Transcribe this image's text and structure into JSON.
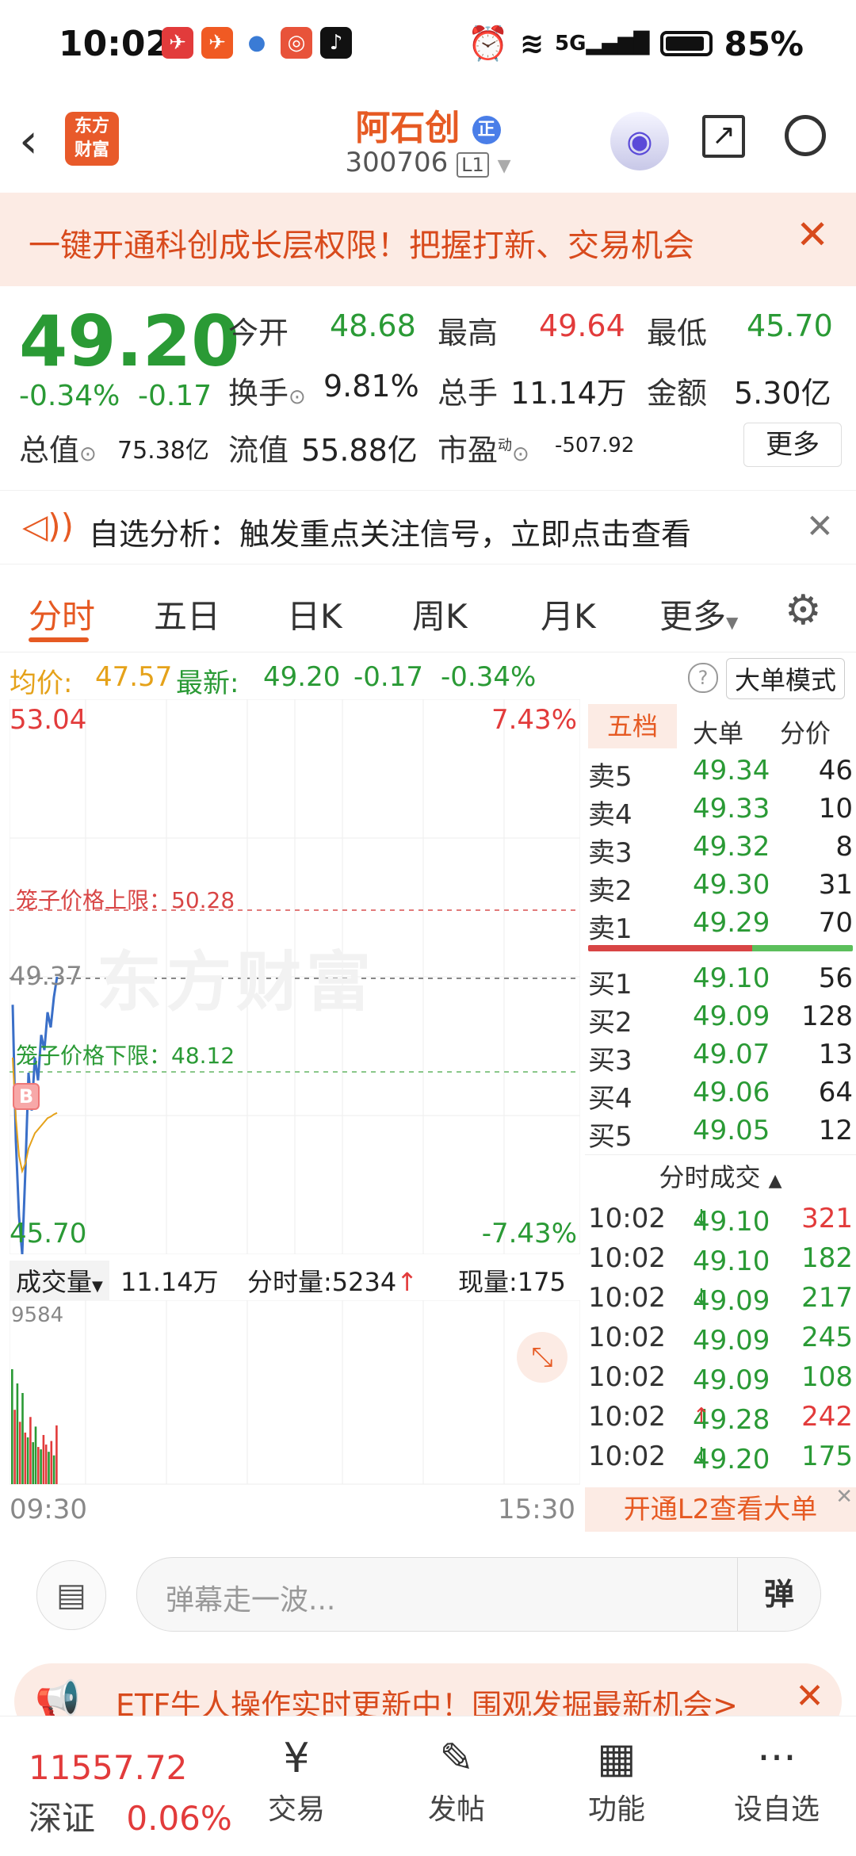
{
  "status_bar": {
    "time": "10:02",
    "network": "5G",
    "battery": "85%"
  },
  "header": {
    "logo_line1": "东方",
    "logo_line2": "财富",
    "stock_name": "阿石创",
    "stock_badge": "正",
    "stock_code": "300706",
    "level_badge": "L1"
  },
  "banner": {
    "text": "一键开通科创成长层权限！把握打新、交易机会"
  },
  "quote": {
    "price": "49.20",
    "change_pct": "-0.34%",
    "change": "-0.17",
    "open_label": "今开",
    "open": "48.68",
    "high_label": "最高",
    "high": "49.64",
    "low_label": "最低",
    "low": "45.70",
    "turnover_label": "换手",
    "turnover": "9.81%",
    "volume_label": "总手",
    "volume": "11.14万",
    "amount_label": "金额",
    "amount": "5.30亿",
    "mktcap_label": "总值",
    "mktcap": "75.38亿",
    "float_label": "流值",
    "float": "55.88亿",
    "pe_label": "市盈",
    "pe_super": "动",
    "pe": "-507.92",
    "more_label": "更多"
  },
  "notice": {
    "text": "自选分析：触发重点关注信号，立即点击查看"
  },
  "tabs": [
    "分时",
    "五日",
    "日K",
    "周K",
    "月K",
    "更多"
  ],
  "summary": {
    "avg_label": "均价:",
    "avg": "47.57",
    "latest_label": "最新:",
    "latest": "49.20",
    "change": "-0.17",
    "change_pct": "-0.34%",
    "mode": "大单模式"
  },
  "chart": {
    "top_price": "53.04",
    "top_pct": "7.43%",
    "bottom_price": "45.70",
    "bottom_pct": "-7.43%",
    "current_price": "49.37",
    "cage_upper_label": "笼子价格上限：50.28",
    "cage_lower_label": "笼子价格下限：48.12",
    "watermark": "东方财富",
    "marker_b": "B",
    "vol_label": "成交量",
    "vol_total": "11.14万",
    "vol_period_label": "分时量:5234",
    "vol_now_label": "现量:175",
    "vol_max": "9584",
    "time_start": "09:30",
    "time_end": "15:30"
  },
  "chart_data": {
    "type": "line",
    "x_range": [
      "09:30",
      "15:30"
    ],
    "ylim": [
      45.7,
      53.04
    ],
    "series": [
      {
        "values": [
          49.0,
          47.2,
          46.2,
          45.7,
          46.8,
          48.1,
          47.6,
          48.3,
          48.0,
          48.6,
          48.4,
          48.9,
          48.7,
          49.1,
          49.37
        ]
      },
      {
        "values": [
          48.3,
          47.5,
          47.0,
          46.8,
          46.9,
          47.1,
          47.2,
          47.3,
          47.35,
          47.4,
          47.45,
          47.5,
          47.52,
          47.55,
          47.57
        ]
      }
    ],
    "volume_values": [
      9584,
      6200,
      8400,
      5200,
      7600,
      4300,
      3900,
      5600,
      3500,
      4800,
      3100,
      2900,
      4100,
      3300,
      2700,
      3600,
      2400,
      4900
    ],
    "volume_colors": [
      "green",
      "red",
      "green",
      "red",
      "green",
      "red",
      "green",
      "red",
      "green",
      "green",
      "red",
      "green",
      "red",
      "red",
      "green",
      "red",
      "green",
      "red"
    ]
  },
  "orderbook": {
    "tabs": [
      "五档",
      "大单",
      "分价"
    ],
    "sells": [
      {
        "label": "卖5",
        "price": "49.34",
        "vol": "46"
      },
      {
        "label": "卖4",
        "price": "49.33",
        "vol": "10"
      },
      {
        "label": "卖3",
        "price": "49.32",
        "vol": "8"
      },
      {
        "label": "卖2",
        "price": "49.30",
        "vol": "31"
      },
      {
        "label": "卖1",
        "price": "49.29",
        "vol": "70"
      }
    ],
    "buys": [
      {
        "label": "买1",
        "price": "49.10",
        "vol": "56"
      },
      {
        "label": "买2",
        "price": "49.09",
        "vol": "128"
      },
      {
        "label": "买3",
        "price": "49.07",
        "vol": "13"
      },
      {
        "label": "买4",
        "price": "49.06",
        "vol": "64"
      },
      {
        "label": "买5",
        "price": "49.05",
        "vol": "12"
      }
    ],
    "trades_title": "分时成交",
    "trades": [
      {
        "time": "10:02",
        "price": "49.10",
        "dir": "↓",
        "vol": "321",
        "color": "red"
      },
      {
        "time": "10:02",
        "price": "49.10",
        "dir": "",
        "vol": "182",
        "color": "green"
      },
      {
        "time": "10:02",
        "price": "49.09",
        "dir": "↓",
        "vol": "217",
        "color": "green"
      },
      {
        "time": "10:02",
        "price": "49.09",
        "dir": "",
        "vol": "245",
        "color": "green"
      },
      {
        "time": "10:02",
        "price": "49.09",
        "dir": "",
        "vol": "108",
        "color": "green"
      },
      {
        "time": "10:02",
        "price": "49.28",
        "dir": "↑",
        "vol": "242",
        "color": "red"
      },
      {
        "time": "10:02",
        "price": "49.20",
        "dir": "↓",
        "vol": "175",
        "color": "green"
      }
    ],
    "l2_label": "开通L2查看大单"
  },
  "danmu": {
    "placeholder": "弹幕走一波...",
    "send_icon": "弹"
  },
  "etf_banner": {
    "text": "ETF牛人操作实时更新中！围观发掘最新机会>"
  },
  "bottom_nav": {
    "index_value": "11557.72",
    "index_name": "深证",
    "index_change": "0.06%",
    "items": [
      {
        "label": "交易",
        "icon": "¥"
      },
      {
        "label": "发帖",
        "icon": "✎"
      },
      {
        "label": "功能",
        "icon": "▦"
      },
      {
        "label": "设自选",
        "icon": "···"
      }
    ]
  }
}
